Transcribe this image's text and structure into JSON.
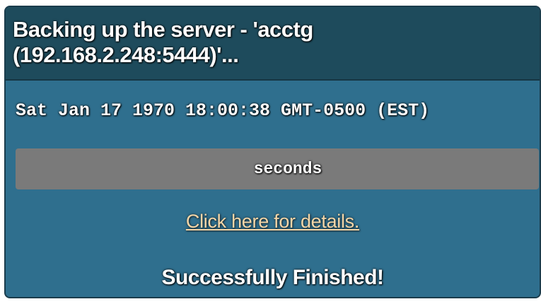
{
  "dialog": {
    "title": "Backing up the server - 'acctg (192.168.2.248:5444)'...",
    "timestamp": "Sat Jan 17 1970 18:00:38 GMT-0500 (EST)",
    "progress": {
      "label": "seconds",
      "percent": 0
    },
    "details_link": "Click here for details.",
    "status": "Successfully Finished!"
  },
  "colors": {
    "panel_bg": "#2f6f8e",
    "header_bg": "#1e4b5c",
    "progress_bg": "#7a7a7a",
    "link": "#f3d6a8"
  }
}
